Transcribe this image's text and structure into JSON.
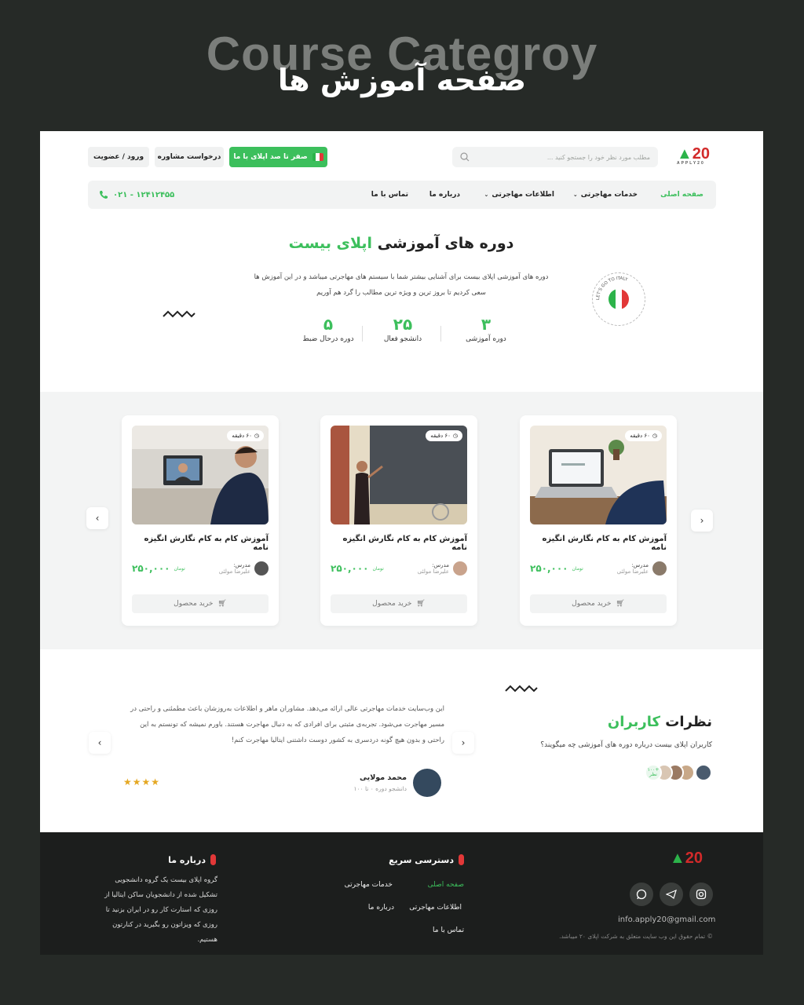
{
  "hero": {
    "english_title": "Course Categroy",
    "persian_title": "صفحه آموزش ها"
  },
  "header": {
    "logo_text": "20",
    "logo_sub": "APPLY20",
    "search_placeholder": "مطلب مورد نظر خود را جستجو کنید ...",
    "cta_button": "صفر تا صد اپلای با ما",
    "consult_button": "درخواست مشاوره",
    "login_button": "ورود / عضویت"
  },
  "nav": {
    "items": [
      {
        "label": "صفحه اصلی",
        "active": true
      },
      {
        "label": "خدمات مهاجرتی",
        "dropdown": true
      },
      {
        "label": "اطلاعات مهاجرتی",
        "dropdown": true
      },
      {
        "label": "درباره ما"
      },
      {
        "label": "تماس با ما"
      }
    ],
    "phone": "۰۲۱ - ۱۲۴۱۲۴۵۵"
  },
  "intro": {
    "title_part1": "دوره های آموزشی",
    "title_part2": "اپلای بیست",
    "description": "دوره های آموزشی اپلای بیست برای آشنایی بیشتر شما با سیستم های مهاجرتی میباشد و در این آموزش ها سعی کردیم تا بروز ترین و ویژه ترین مطالب را گرد هم آوریم",
    "badge_text": "LET'S GO TO ITALY",
    "stats": [
      {
        "value": "۳",
        "label": "دوره آموزشی"
      },
      {
        "value": "۲۵",
        "label": "دانشجو فعال"
      },
      {
        "value": "۵",
        "label": "دوره درحال ضبط"
      }
    ]
  },
  "courses": [
    {
      "duration": "۶۰ دقیقه",
      "title": "آموزش کام به کام نگارش انگیزه نامه",
      "teacher_label": "مدرس:",
      "teacher_name": "علیرضا مولئی",
      "price": "۲۵۰,۰۰۰",
      "unit": "تومان",
      "buy": "خرید محصول"
    },
    {
      "duration": "۶۰ دقیقه",
      "title": "آموزش کام به کام نگارش انگیزه نامه",
      "teacher_label": "مدرس:",
      "teacher_name": "علیرضا مولئی",
      "price": "۲۵۰,۰۰۰",
      "unit": "تومان",
      "buy": "خرید محصول"
    },
    {
      "duration": "۶۰ دقیقه",
      "title": "آموزش کام به کام نگارش انگیزه نامه",
      "teacher_label": "مدرس:",
      "teacher_name": "علیرضا مولئی",
      "price": "۲۵۰,۰۰۰",
      "unit": "تومان",
      "buy": "خرید محصول"
    }
  ],
  "reviews": {
    "title_part1": "نظرات",
    "title_part2": "کاربران",
    "subtitle": "کاربران اپلای بیست درباره دوره های آموزشی چه میگویند؟",
    "count_badge": "+۱۰۰ نظر",
    "quote": "این وب‌سایت خدمات مهاجرتی عالی ارائه می‌دهد. مشاوران ماهر و اطلاعات به‌روزشان باعث مطمئنی و راحتی در مسیر مهاجرت می‌شود. تجربه‌ی مثبتی برای افرادی که به دنبال مهاجرت هستند. باورم نمیشه که تونستم به این راحتی و بدون هیچ گونه دردسری به کشور دوست داشتنی ایتالیا مهاجرت کنم!",
    "reviewer_name": "محمد مولایی",
    "reviewer_sub": "دانشجو دوره ۰ تا ۱۰۰",
    "stars": "★★★★"
  },
  "footer": {
    "about_title": "درباره ما",
    "about_text": "گروه اپلای بیست یک گروه دانشجویی تشکیل شده از دانشجویان ساکن ایتالیا از روزی که استارت کار رو در ایران بزنید تا روزی که ویزاتون رو بگیرید در کنارتون هستیم.",
    "quick_title": "دسترسی سریع",
    "links": [
      "صفحه اصلی",
      "خدمات مهاجرتی",
      "اطلاعات مهاجرتی",
      "درباره ما",
      "تماس با ما"
    ],
    "email": "info.apply20@gmail.com",
    "copyright": "© تمام حقوق این وب سایت متعلق به شرکت اپلای ۲۰ میباشد."
  },
  "colors": {
    "accent": "#3cbf5c",
    "brand_red": "#d22a2a",
    "dark_bg": "#262a27"
  }
}
